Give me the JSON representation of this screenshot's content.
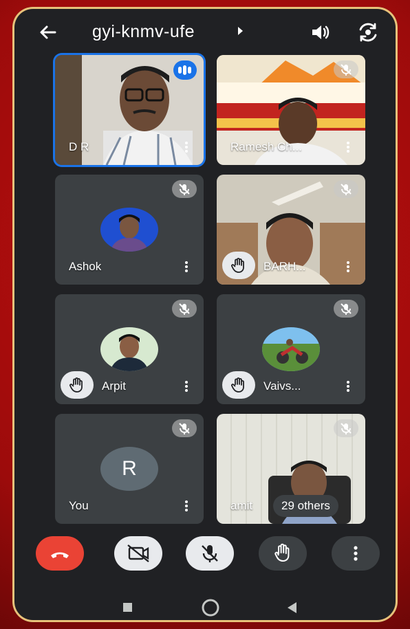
{
  "meeting": {
    "code": "gyi-knmv-ufe"
  },
  "participants": [
    {
      "name": "D R",
      "state": "speaking"
    },
    {
      "name": "Ramesh Ch...",
      "state": "muted"
    },
    {
      "name": "Ashok",
      "state": "muted"
    },
    {
      "name": "BARH...",
      "state": "muted",
      "hand_raised": true
    },
    {
      "name": "Arpit",
      "state": "muted",
      "hand_raised": true
    },
    {
      "name": "Vaivs...",
      "state": "muted",
      "hand_raised": true
    },
    {
      "name": "You",
      "state": "muted",
      "avatar_letter": "R"
    },
    {
      "name": "amit",
      "state": "muted"
    }
  ],
  "others_label": "29 others",
  "controls": [
    {
      "name": "end-call",
      "icon": "phone-hangup-icon",
      "color": "#ea4335"
    },
    {
      "name": "camera",
      "icon": "camera-off-icon",
      "color": "#e8eaed"
    },
    {
      "name": "microphone",
      "icon": "mic-off-icon",
      "color": "#e8eaed"
    },
    {
      "name": "raise-hand",
      "icon": "hand-icon",
      "color": "#3c4043"
    },
    {
      "name": "more",
      "icon": "more-vert-icon",
      "color": "#3c4043"
    }
  ],
  "nav": [
    "square-icon",
    "circle-icon",
    "back-triangle-icon"
  ],
  "colors": {
    "accent": "#1a73e8",
    "bg": "#202124",
    "tile": "#3c4043",
    "end": "#ea4335"
  }
}
